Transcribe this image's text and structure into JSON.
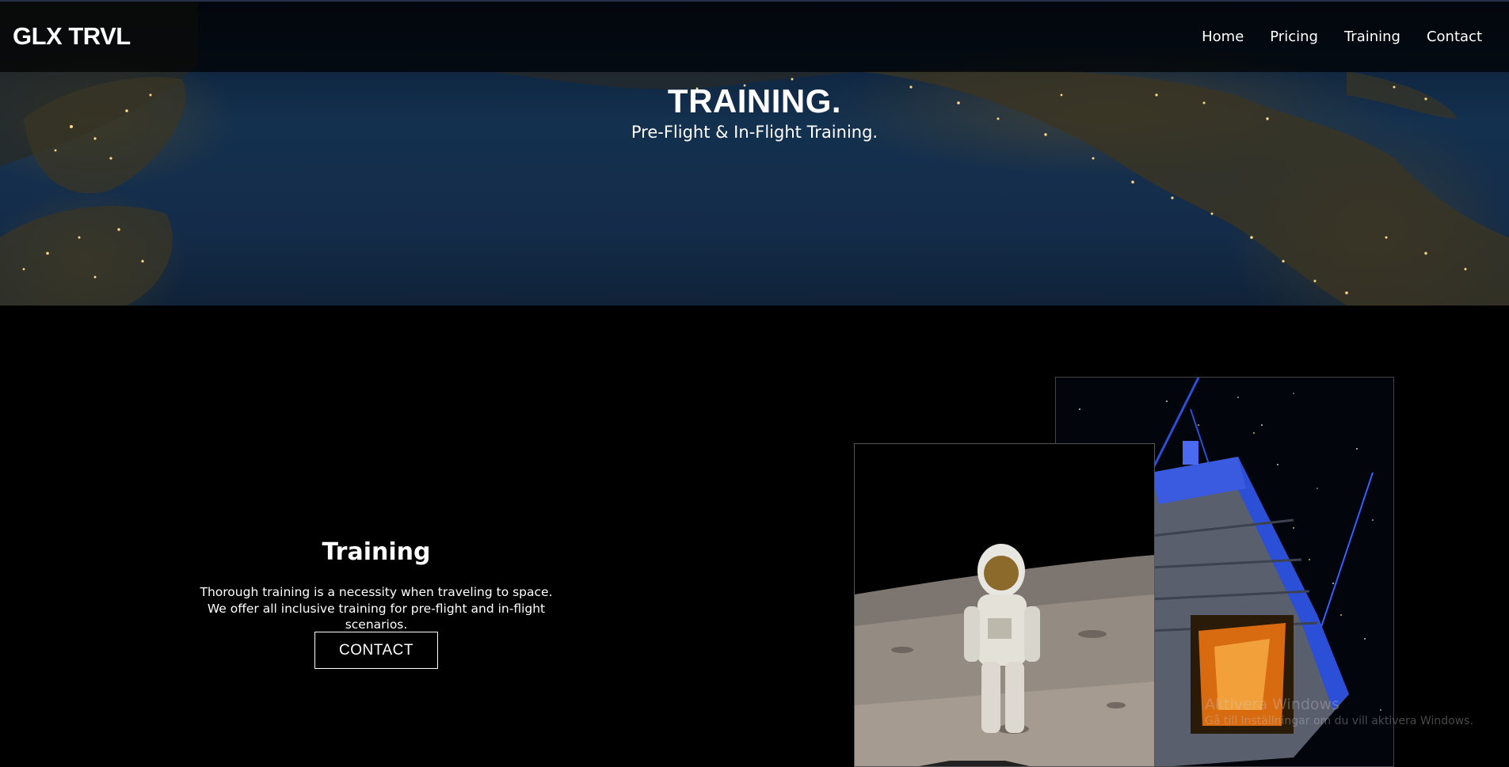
{
  "brand": {
    "logo": "GLX TRVL"
  },
  "nav": {
    "items": [
      {
        "label": "Home"
      },
      {
        "label": "Pricing"
      },
      {
        "label": "Training"
      },
      {
        "label": "Contact"
      }
    ]
  },
  "hero": {
    "title": "TRAINING.",
    "subtitle": "Pre-Flight & In-Flight Training."
  },
  "section": {
    "title": "Training",
    "body": "Thorough training is a necessity when traveling to space. We offer all inclusive training for pre-flight and in-flight scenarios.",
    "button_label": "CONTACT"
  },
  "watermark": {
    "title": "Aktivera Windows",
    "subtitle": "Gå till Inställningar om du vill aktivera Windows."
  },
  "colors": {
    "background": "#000000",
    "text": "#ffffff",
    "hero_ocean": "#13304f",
    "city_lights": "#ffd98a",
    "capsule_blue": "#2b4fd6"
  }
}
